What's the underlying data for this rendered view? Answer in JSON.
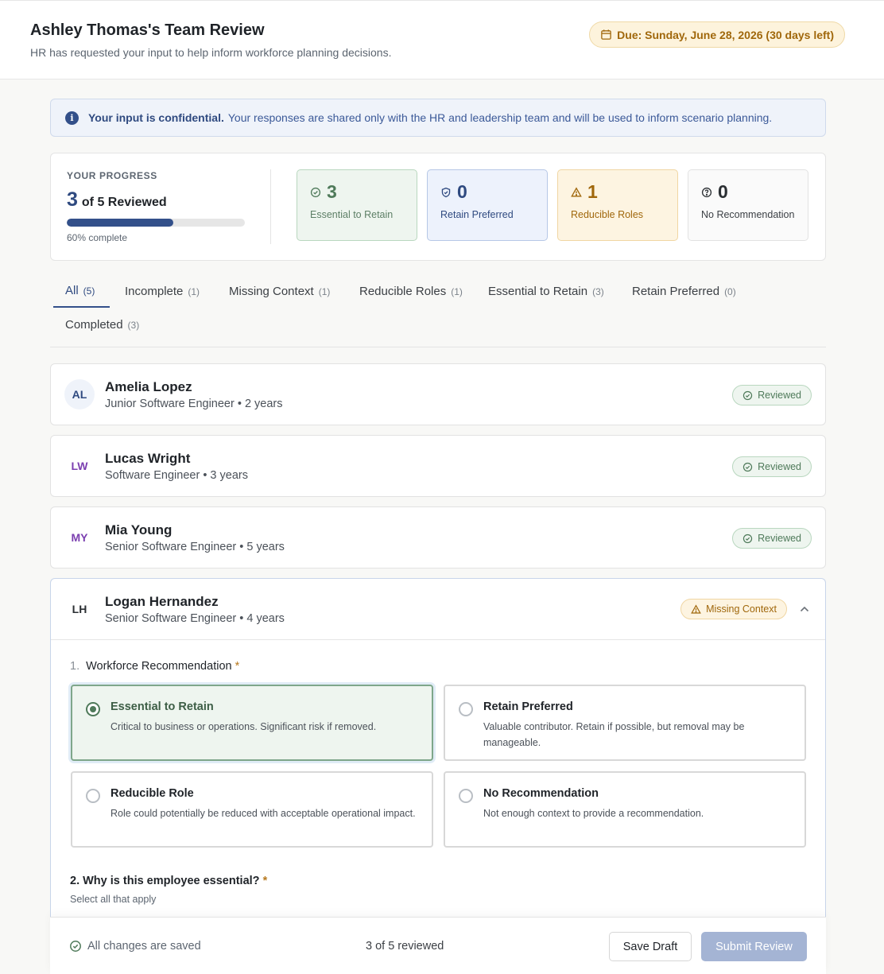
{
  "header": {
    "title": "Ashley Thomas's Team Review",
    "subtitle": "HR has requested your input to help inform workforce planning decisions.",
    "due": "Due: Sunday, June 28, 2026 (30 days left)"
  },
  "banner": {
    "strong": "Your input is confidential.",
    "text": "Your responses are shared only with the HR and leadership team and will be used to inform scenario planning."
  },
  "progress": {
    "label": "YOUR PROGRESS",
    "reviewed": "3",
    "of_text": "of 5 Reviewed",
    "percent_text": "60% complete",
    "fraction": 0.6
  },
  "stats": [
    {
      "value": "3",
      "label": "Essential to Retain"
    },
    {
      "value": "0",
      "label": "Retain Preferred"
    },
    {
      "value": "1",
      "label": "Reducible Roles"
    },
    {
      "value": "0",
      "label": "No Recommendation"
    }
  ],
  "tabs": [
    {
      "label": "All",
      "count": "(5)"
    },
    {
      "label": "Incomplete",
      "count": "(1)"
    },
    {
      "label": "Missing Context",
      "count": "(1)"
    },
    {
      "label": "Reducible Roles",
      "count": "(1)"
    },
    {
      "label": "Essential to Retain",
      "count": "(3)"
    },
    {
      "label": "Retain Preferred",
      "count": "(0)"
    },
    {
      "label": "Completed",
      "count": "(3)"
    }
  ],
  "employees": [
    {
      "initials": "AL",
      "name": "Amelia Lopez",
      "role": "Junior Software Engineer • 2 years",
      "status": "Reviewed"
    },
    {
      "initials": "LW",
      "name": "Lucas Wright",
      "role": "Software Engineer • 3 years",
      "status": "Reviewed"
    },
    {
      "initials": "MY",
      "name": "Mia Young",
      "role": "Senior Software Engineer • 5 years",
      "status": "Reviewed"
    },
    {
      "initials": "LH",
      "name": "Logan Hernandez",
      "role": "Senior Software Engineer • 4 years",
      "status": "Missing Context"
    }
  ],
  "form": {
    "q1_num": "1.",
    "q1_label": "Workforce Recommendation",
    "required_mark": "*",
    "options": [
      {
        "title": "Essential to Retain",
        "desc": "Critical to business or operations. Significant risk if removed."
      },
      {
        "title": "Retain Preferred",
        "desc": "Valuable contributor. Retain if possible, but removal may be manageable."
      },
      {
        "title": "Reducible Role",
        "desc": "Role could potentially be reduced with acceptable operational impact."
      },
      {
        "title": "No Recommendation",
        "desc": "Not enough context to provide a recommendation."
      }
    ],
    "q2_label": "2. Why is this employee essential?",
    "q2_sub": "Select all that apply"
  },
  "footer": {
    "saved": "All changes are saved",
    "count": "3 of 5 reviewed",
    "save_draft": "Save Draft",
    "submit": "Submit Review"
  },
  "colors": {
    "accent": "#33508a",
    "green": "#4f7a5a",
    "amber": "#a0670b"
  }
}
